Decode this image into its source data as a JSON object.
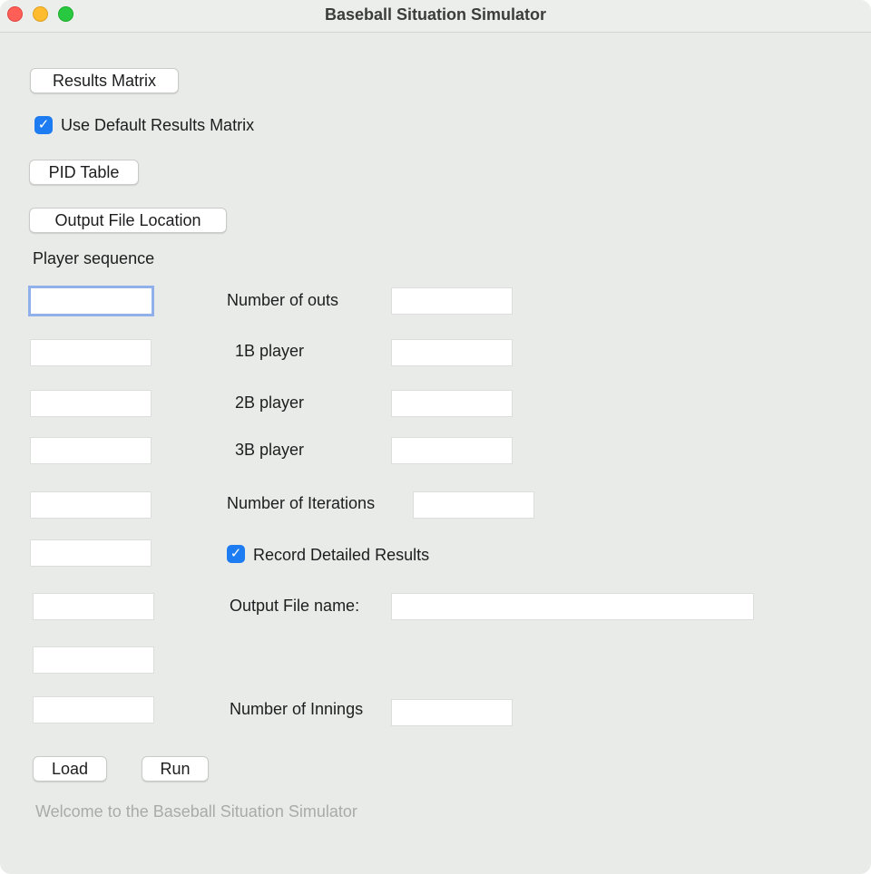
{
  "window": {
    "title": "Baseball Situation Simulator"
  },
  "buttons": {
    "results_matrix": "Results Matrix",
    "pid_table": "PID Table",
    "output_file_location": "Output File Location",
    "load": "Load",
    "run": "Run"
  },
  "checkboxes": {
    "use_default_results_matrix": {
      "label": "Use Default Results Matrix",
      "checked": true
    },
    "record_detailed_results": {
      "label": "Record Detailed Results",
      "checked": true
    }
  },
  "labels": {
    "player_sequence": "Player sequence",
    "number_of_outs": "Number of outs",
    "first_base_player": "1B player",
    "second_base_player": "2B player",
    "third_base_player": "3B player",
    "number_of_iterations": "Number of Iterations",
    "output_file_name": "Output File name:",
    "number_of_innings": "Number of Innings"
  },
  "status_text": "Welcome to the Baseball Situation Simulator",
  "colors": {
    "window_background": "#e9ebe8",
    "checkbox_accent": "#1e7cf2",
    "focus_ring": "#8fb0ea",
    "status_text": "#a9aba8"
  }
}
